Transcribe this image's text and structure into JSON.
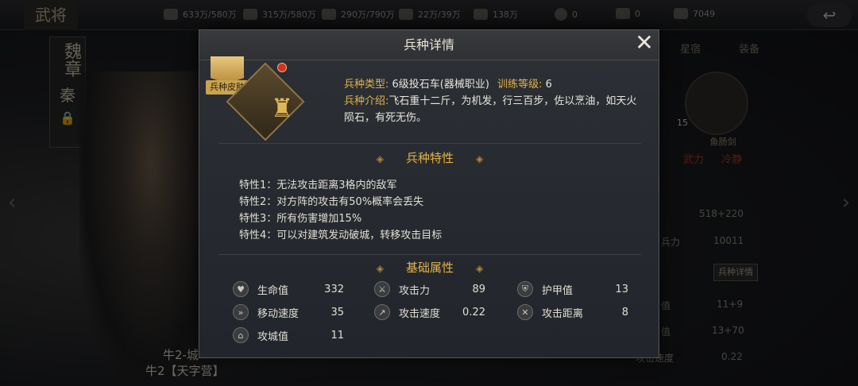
{
  "background": {
    "title": "武将",
    "resources": [
      {
        "icon": "wood-icon",
        "value": "633万/580万"
      },
      {
        "icon": "iron-icon",
        "value": "315万/580万"
      },
      {
        "icon": "food-icon",
        "value": "290万/790万"
      },
      {
        "icon": "stone-icon",
        "value": "22万/39万"
      },
      {
        "icon": "token-icon",
        "value": "138万"
      },
      {
        "icon": "coin-icon",
        "value": "0"
      },
      {
        "icon": "gold-icon",
        "value": "0"
      },
      {
        "icon": "silver-icon",
        "value": "7049"
      }
    ],
    "general": {
      "name": "魏章",
      "country": "秦"
    },
    "troop_label_1": "牛2-城",
    "troop_label_2": "牛2【天字营】",
    "right_tabs": [
      "星宿",
      "装备"
    ],
    "equip": {
      "level": "15",
      "name": "鱼肠剑",
      "tag1": "武力",
      "tag2": "冷静"
    },
    "right_values": [
      {
        "label": "",
        "value": "518+220"
      },
      {
        "label": "兵力",
        "value": "10011"
      },
      {
        "label": "值",
        "value": "11+9"
      },
      {
        "label": "值",
        "value": "13+70"
      },
      {
        "label": "攻击速度",
        "value": "0.22"
      }
    ],
    "right_button": "兵种详情"
  },
  "modal": {
    "title": "兵种详情",
    "skin_badge": "兵种皮肤",
    "type_label": "兵种类型:",
    "type_value": "6级投石车(器械职业)",
    "training_label": "训练等级:",
    "training_value": "6",
    "intro_label": "兵种介绍:",
    "intro_value": "飞石重十二斤，为机发，行三百步，佐以烹油，如天火陨石，有死无伤。",
    "traits_title": "兵种特性",
    "traits": [
      "特性1：无法攻击距离3格内的敌军",
      "特性2：对方阵的攻击有50%概率会丢失",
      "特性3：所有伤害增加15%",
      "特性4：可以对建筑发动破城，转移攻击目标"
    ],
    "base_title": "基础属性",
    "stats": [
      {
        "icon": "heart-icon",
        "label": "生命值",
        "value": "332"
      },
      {
        "icon": "attack-icon",
        "label": "攻击力",
        "value": "89"
      },
      {
        "icon": "armor-icon",
        "label": "护甲值",
        "value": "13"
      },
      {
        "icon": "boot-icon",
        "label": "移动速度",
        "value": "35"
      },
      {
        "icon": "attack-speed-icon",
        "label": "攻击速度",
        "value": "0.22"
      },
      {
        "icon": "range-icon",
        "label": "攻击距离",
        "value": "8"
      },
      {
        "icon": "siege-icon",
        "label": "攻城值",
        "value": "11"
      }
    ]
  }
}
